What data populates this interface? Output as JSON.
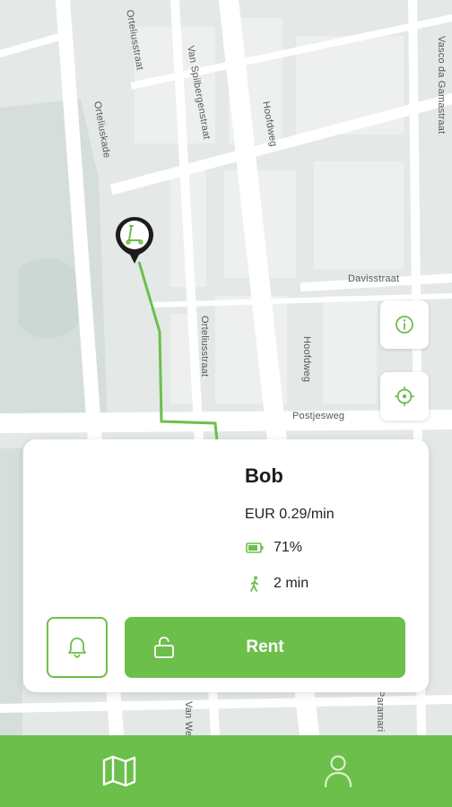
{
  "map": {
    "streets": {
      "ortelius_top": "Orteliusstraat",
      "orteliuskade": "Orteliuskade",
      "van_spilbergen": "Van Spilbergenstraat",
      "hoofdweg_top": "Hoofdweg",
      "vasco": "Vasco da Gamastraat",
      "davisstraat": "Davisstraat",
      "ortelius_mid": "Orteliusstraat",
      "hoofdweg_mid": "Hoofdweg",
      "postjesweg": "Postjesweg",
      "van_w": "Van We",
      "paramari": "Paramari"
    },
    "route_color": "#6cbf4b",
    "pin_icon": "scooter-icon"
  },
  "buttons": {
    "info_icon": "info-icon",
    "locate_icon": "crosshair-icon"
  },
  "vehicle": {
    "name": "Bob",
    "price": "EUR 0.29/min",
    "battery": "71%",
    "walk_time": "2 min"
  },
  "actions": {
    "rent_label": "Rent",
    "bell_icon": "bell-icon",
    "lock_icon": "unlock-icon"
  },
  "nav": {
    "map_icon": "map-icon",
    "profile_icon": "user-icon"
  },
  "colors": {
    "accent": "#6cbf4b",
    "map_background": "#e6ebe9",
    "road": "#ffffff"
  }
}
